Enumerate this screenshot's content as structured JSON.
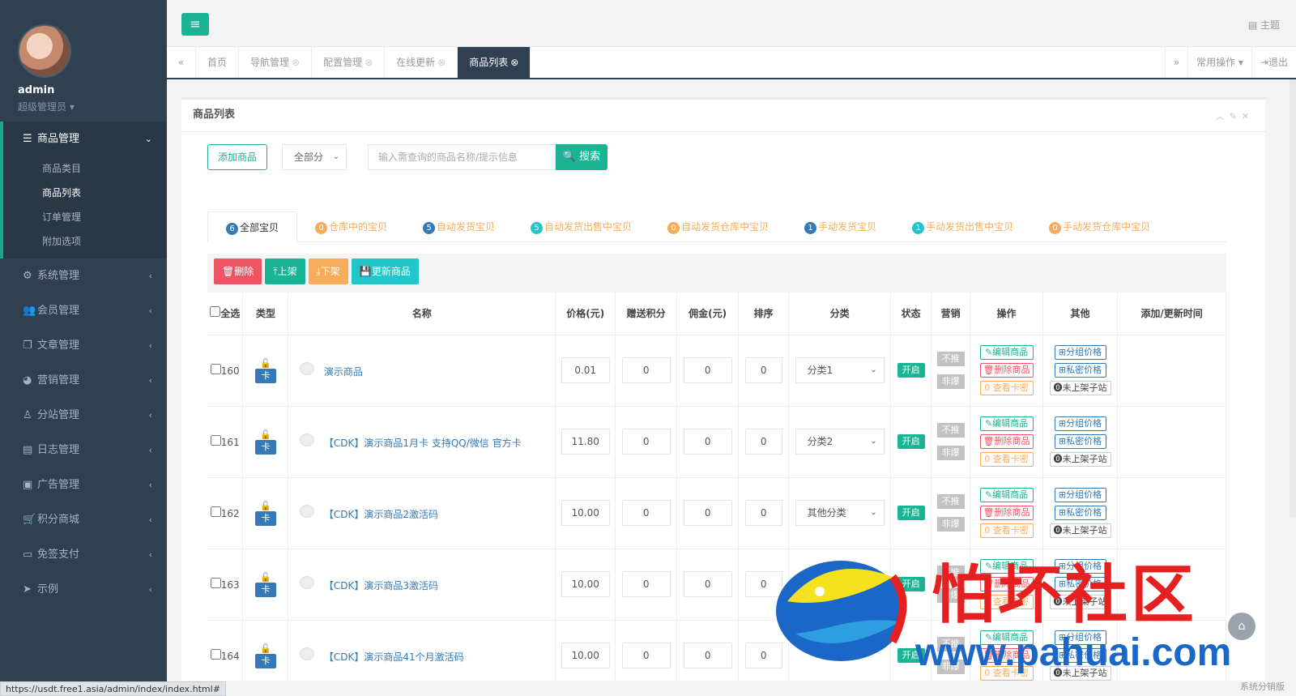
{
  "sidebar": {
    "user_name": "admin",
    "user_role": "超级管理员",
    "menu": [
      {
        "label": "商品管理",
        "icon": "list-icon",
        "active": true
      },
      {
        "label": "系统管理",
        "icon": "gear-icon"
      },
      {
        "label": "会员管理",
        "icon": "users-icon"
      },
      {
        "label": "文章管理",
        "icon": "copy-icon"
      },
      {
        "label": "营销管理",
        "icon": "pie-icon"
      },
      {
        "label": "分站管理",
        "icon": "person-icon"
      },
      {
        "label": "日志管理",
        "icon": "log-icon"
      },
      {
        "label": "广告管理",
        "icon": "image-icon"
      },
      {
        "label": "积分商城",
        "icon": "cart-icon"
      },
      {
        "label": "免签支付",
        "icon": "card-icon"
      },
      {
        "label": "示例",
        "icon": "send-icon"
      }
    ],
    "submenu": [
      "商品类目",
      "商品列表",
      "订单管理",
      "附加选项"
    ]
  },
  "topbar": {
    "theme_label": "主题"
  },
  "tabs": [
    "首页",
    "导航管理",
    "配置管理",
    "在线更新",
    "商品列表"
  ],
  "tab_right": {
    "common_ops": "常用操作",
    "logout": "退出"
  },
  "panel": {
    "title": "商品列表",
    "add_button": "添加商品",
    "filter_select": "全部分",
    "search_placeholder": "输入需查询的商品名称/提示信息",
    "search_button": "搜索"
  },
  "filters": [
    {
      "count": "6",
      "label": "全部宝贝",
      "color": "#337ab7"
    },
    {
      "count": "0",
      "label": "仓库中的宝贝",
      "color": "#f8ac59"
    },
    {
      "count": "5",
      "label": "自动发货宝贝",
      "color": "#337ab7"
    },
    {
      "count": "5",
      "label": "自动发货出售中宝贝",
      "color": "#23c6c8"
    },
    {
      "count": "0",
      "label": "自动发货仓库中宝贝",
      "color": "#f8ac59"
    },
    {
      "count": "1",
      "label": "手动发货宝贝",
      "color": "#337ab7"
    },
    {
      "count": "1",
      "label": "手动发货出售中宝贝",
      "color": "#23c6c8"
    },
    {
      "count": "0",
      "label": "手动发货仓库中宝贝",
      "color": "#f8ac59"
    }
  ],
  "bulk_actions": [
    {
      "label": "删除",
      "color": "#ed5565"
    },
    {
      "label": "上架",
      "color": "#1ab394"
    },
    {
      "label": "下架",
      "color": "#f8ac59"
    },
    {
      "label": "更新商品",
      "color": "#23c6c8"
    }
  ],
  "columns": [
    "全选",
    "类型",
    "名称",
    "价格(元)",
    "赠送积分",
    "佣金(元)",
    "排序",
    "分类",
    "状态",
    "营销",
    "操作",
    "其他",
    "添加/更新时间"
  ],
  "rows": [
    {
      "id": "160",
      "type": "卡",
      "name": "演示商品",
      "price": "0.01",
      "points": "0",
      "commission": "0",
      "sort": "0",
      "category": "分类1",
      "status": "开启"
    },
    {
      "id": "161",
      "type": "卡",
      "name": "【CDK】演示商品1月卡 支持QQ/微信 官方卡",
      "price": "11.80",
      "points": "0",
      "commission": "0",
      "sort": "0",
      "category": "分类2",
      "status": "开启"
    },
    {
      "id": "162",
      "type": "卡",
      "name": "【CDK】演示商品2激活码",
      "price": "10.00",
      "points": "0",
      "commission": "0",
      "sort": "0",
      "category": "其他分类",
      "status": "开启"
    },
    {
      "id": "163",
      "type": "卡",
      "name": "【CDK】演示商品3激活码",
      "price": "10.00",
      "points": "0",
      "commission": "0",
      "sort": "0",
      "category": "",
      "status": "开启"
    },
    {
      "id": "164",
      "type": "卡",
      "name": "【CDK】演示商品41个月激活码",
      "price": "10.00",
      "points": "0",
      "commission": "0",
      "sort": "0",
      "category": "",
      "status": "开启"
    }
  ],
  "row_labels": {
    "not_recommend": "不推",
    "not_hot": "非爆",
    "edit": "编辑商品",
    "delete": "删除商品",
    "view_keys": "0 查看卡密",
    "group_price": "分组价格",
    "private_price": "私密价格",
    "not_listed": "未上架子站"
  },
  "statusbar_url": "https://usdt.free1.asia/admin/index/index.html#",
  "footer_text": "系统分销版",
  "watermark": {
    "cn": "怕坏社区",
    "url": "www.pahuai.com"
  }
}
